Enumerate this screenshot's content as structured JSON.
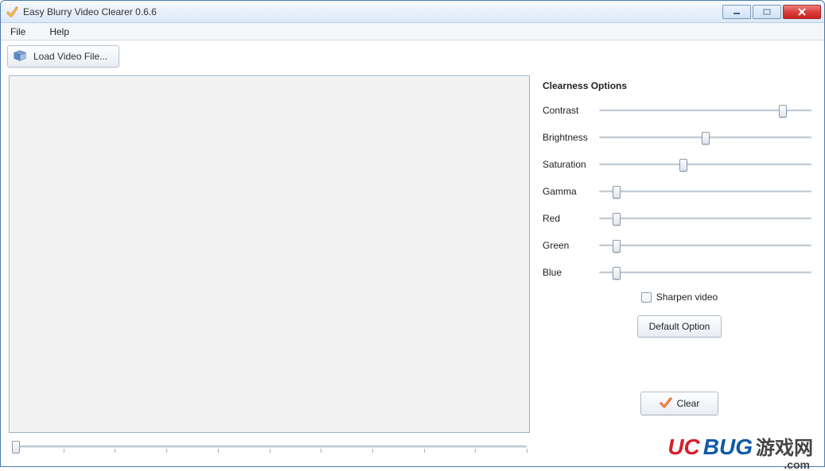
{
  "window": {
    "title": "Easy Blurry Video Clearer 0.6.6"
  },
  "menu": {
    "file": "File",
    "help": "Help"
  },
  "toolbar": {
    "load_label": "Load Video File..."
  },
  "options": {
    "title": "Clearness Options",
    "sliders": [
      {
        "label": "Contrast",
        "value": 85
      },
      {
        "label": "Brightness",
        "value": 50
      },
      {
        "label": "Saturation",
        "value": 40
      },
      {
        "label": "Gamma",
        "value": 10
      },
      {
        "label": "Red",
        "value": 10
      },
      {
        "label": "Green",
        "value": 10
      },
      {
        "label": "Blue",
        "value": 10
      }
    ],
    "sharpen_label": "Sharpen video",
    "sharpen_checked": false,
    "default_button": "Default Option"
  },
  "actions": {
    "clear_label": "Clear"
  },
  "timeline": {
    "position": 0
  },
  "watermark": {
    "part1": "UC",
    "part2": "BUG",
    "cn": "游戏网",
    "sub": ".com"
  }
}
